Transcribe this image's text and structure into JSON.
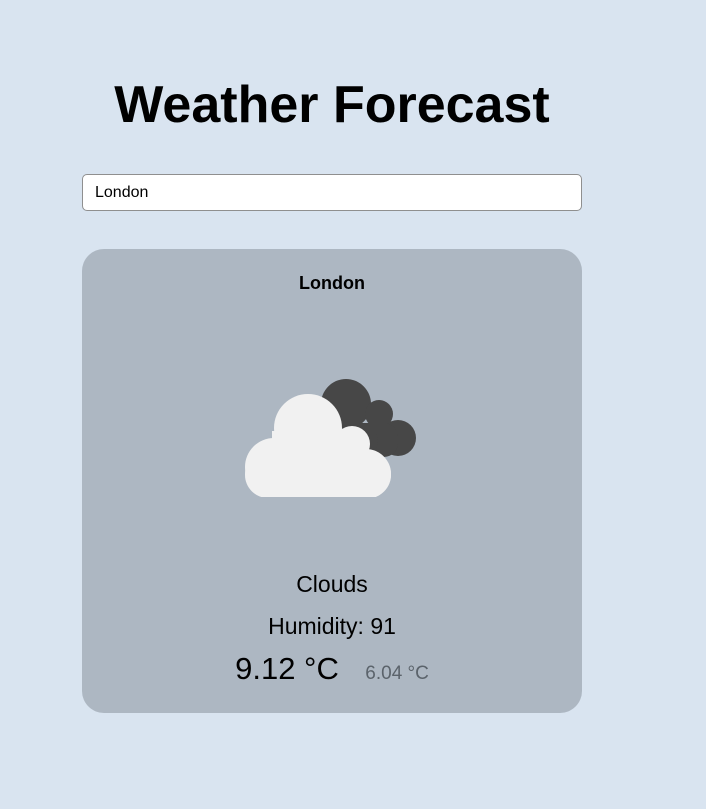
{
  "header": {
    "title": "Weather Forecast"
  },
  "search": {
    "value": "London",
    "placeholder": ""
  },
  "weather": {
    "city": "London",
    "icon": "clouds-icon",
    "description": "Clouds",
    "humidity_text": "Humidity: 91",
    "temperature": "9.12 °C",
    "feels_like": "6.04 °C"
  },
  "colors": {
    "background": "#d9e4f0",
    "card": "#adb7c2",
    "cloud_front": "#f1f1f1",
    "cloud_back": "#474747"
  }
}
